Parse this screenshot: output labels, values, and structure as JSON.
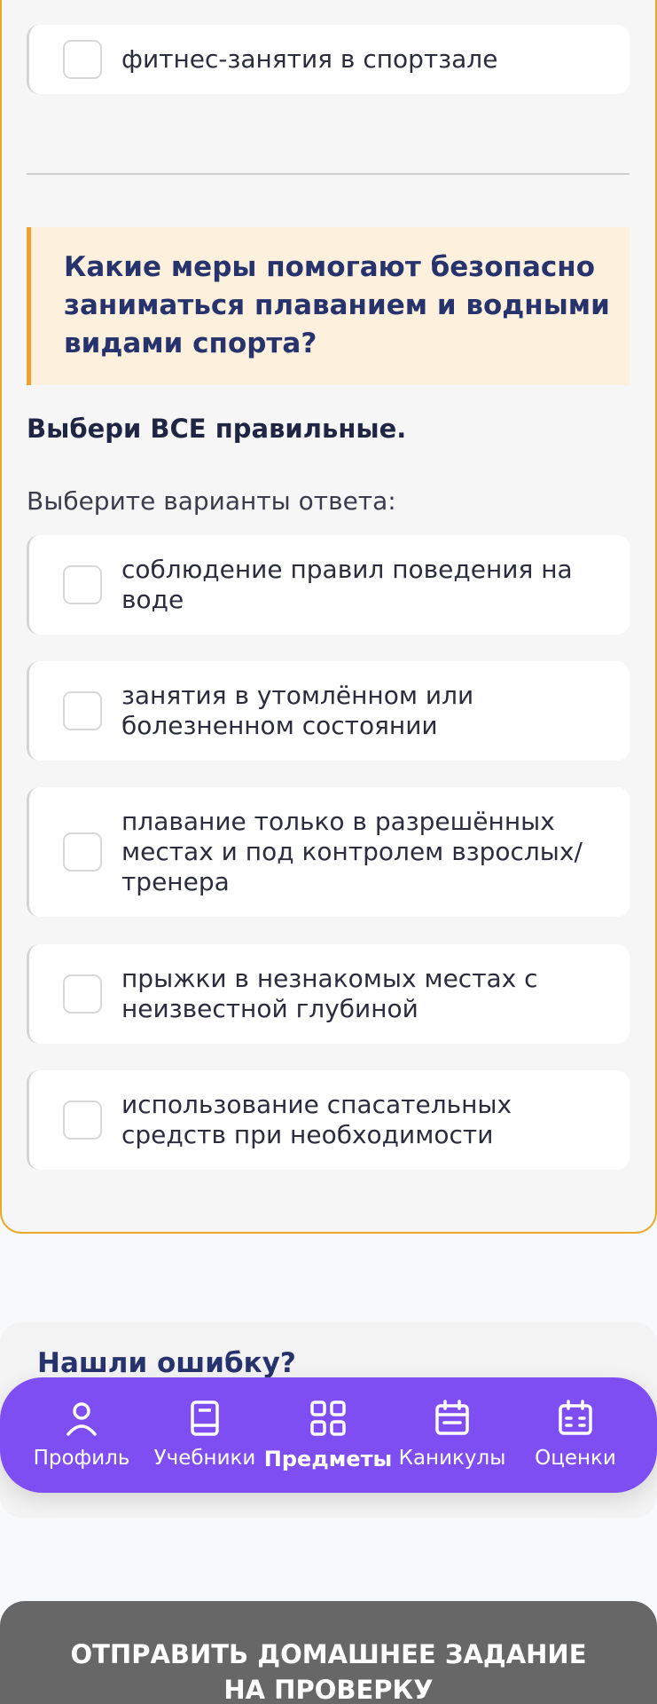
{
  "prev_option": {
    "label": "фитнес-занятия в спортзале"
  },
  "question": {
    "text": "Какие меры помогают безопасно заниматься плаванием и водными видами спорта?",
    "instruction": "Выбери ВСЕ правильные.",
    "choose_label": "Выберите варианты ответа:",
    "options": [
      {
        "label": "соблюдение правил поведения на воде"
      },
      {
        "label": "занятия в утомлённом или болезненном состоянии"
      },
      {
        "label": "плавание только в разрешённых местах и под контролем взрослых/тренера"
      },
      {
        "label": "прыжки в незнакомых местах с неизвестной глубиной"
      },
      {
        "label": "использование спасательных средств при необходимости"
      }
    ]
  },
  "error_report": {
    "title": "Нашли ошибку?"
  },
  "nav": {
    "items": [
      {
        "label": "Профиль",
        "icon": "user-icon"
      },
      {
        "label": "Учебники",
        "icon": "book-icon"
      },
      {
        "label": "Предметы",
        "icon": "grid-icon",
        "active": true
      },
      {
        "label": "Каникулы",
        "icon": "calendar-icon"
      },
      {
        "label": "Оценки",
        "icon": "calendar-grid-icon"
      }
    ]
  },
  "submit": {
    "label": "ОТПРАВИТЬ ДОМАШНЕЕ ЗАДАНИЕ НА ПРОВЕРКУ"
  },
  "colors": {
    "accent": "#7f4ef3",
    "question_border": "#f0a12d",
    "question_bg": "#fdf1dd",
    "heading": "#27336d",
    "submit_bg": "#676767"
  }
}
